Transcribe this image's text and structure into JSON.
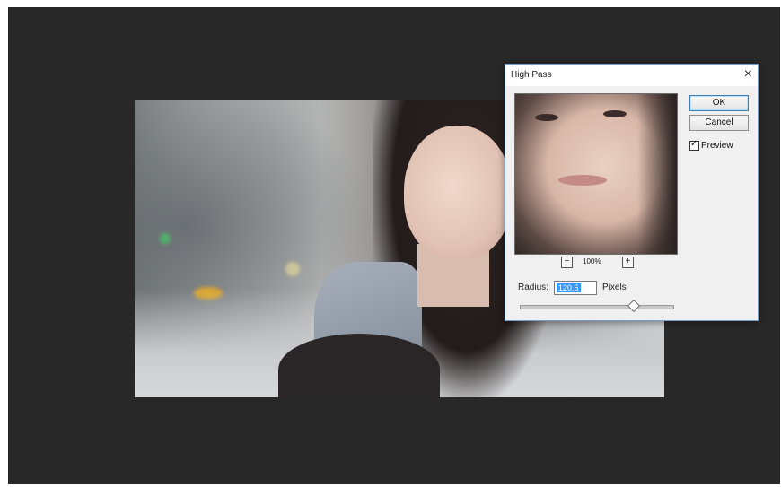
{
  "dialog": {
    "title": "High Pass",
    "close_glyph": "×",
    "ok_label": "OK",
    "cancel_label": "Cancel",
    "preview_label": "Preview",
    "preview_checked": true,
    "zoom_out_glyph": "−",
    "zoom_in_glyph": "+",
    "zoom_level": "100%",
    "radius_label": "Radius:",
    "radius_value": "120.5",
    "radius_unit": "Pixels",
    "slider_fraction": 0.74
  },
  "icons": {
    "close": "close-icon",
    "zoom_out": "zoom-out-icon",
    "zoom_in": "zoom-in-icon",
    "checkmark": "checkmark-icon"
  },
  "colors": {
    "workspace_bg": "#282828",
    "selection": "#3399ff",
    "dialog_border": "#7a9ec9"
  }
}
